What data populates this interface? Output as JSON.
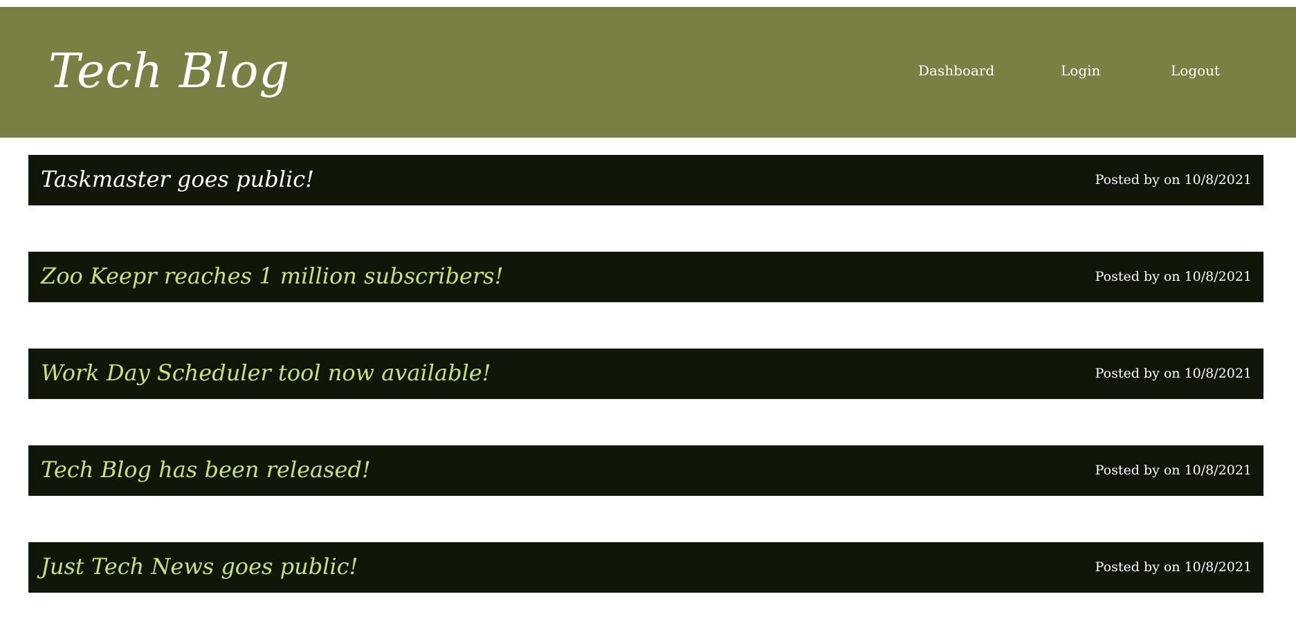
{
  "header": {
    "title": "Tech Blog",
    "nav": {
      "dashboard": "Dashboard",
      "login": "Login",
      "logout": "Logout"
    }
  },
  "posts": [
    {
      "title": "Taskmaster goes public!",
      "meta": "Posted by on 10/8/2021"
    },
    {
      "title": "Zoo Keepr reaches 1 million subscribers!",
      "meta": "Posted by on 10/8/2021"
    },
    {
      "title": "Work Day Scheduler tool now available!",
      "meta": "Posted by on 10/8/2021"
    },
    {
      "title": "Tech Blog has been released!",
      "meta": "Posted by on 10/8/2021"
    },
    {
      "title": "Just Tech News goes public!",
      "meta": "Posted by on 10/8/2021"
    }
  ],
  "colors": {
    "header_bg": "#7a7f43",
    "post_bg": "#101709",
    "post_title": "#cde07c",
    "text_light": "#ffffff"
  }
}
